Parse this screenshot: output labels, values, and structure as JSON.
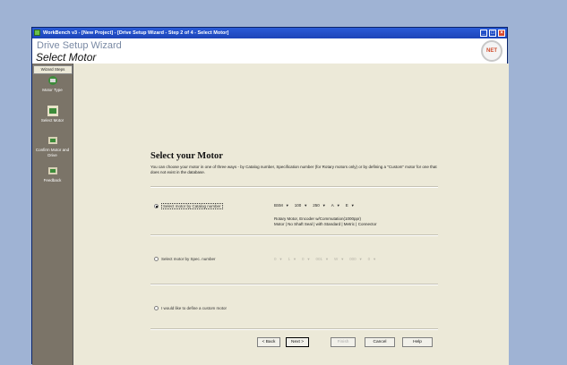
{
  "window": {
    "title": "WorkBench v3 - [New Project] - [Drive Setup Wizard - Step 2 of 4 - Select Motor]",
    "app_name": "Drive Setup Wizard",
    "page_name": "Select Motor",
    "logo_text": "NET"
  },
  "sidebar": {
    "header": "Wizard Steps",
    "steps": [
      {
        "label": "Motor Type",
        "icon": "motor-type-icon"
      },
      {
        "label": "Select Motor",
        "icon": "select-motor-icon"
      },
      {
        "label": "Confirm Motor and Drive",
        "icon": "confirm-motor-icon"
      },
      {
        "label": "Feedback",
        "icon": "feedback-icon"
      }
    ]
  },
  "main": {
    "heading": "Select your Motor",
    "intro": "You can choose your motor in one of three ways - by Catalog number, Specification number (for Rotary motors only) or by defining a \"Custom\" motor for one that does not exist in the database.",
    "option_catalog": {
      "label": "Select motor by Catalog number",
      "selected": true,
      "dropdowns": [
        "BSM",
        "100",
        "250",
        "A",
        "E"
      ],
      "info_line1": "Rotary Motor, Encoder w/Commutation(1000ppr)",
      "info_line2": "Motor | No Shaft Seal | with Standard | Metric | Connector"
    },
    "option_spec": {
      "label": "Select motor by Spec. number",
      "selected": false,
      "dropdowns": [
        "0",
        "1",
        "0",
        "001",
        "W",
        "000",
        "0"
      ]
    },
    "option_custom": {
      "label": "I would like to define a custom motor",
      "selected": false
    }
  },
  "buttons": {
    "back": "< Back",
    "next": "Next >",
    "finish": "Finish",
    "cancel": "Cancel",
    "help": "Help"
  }
}
